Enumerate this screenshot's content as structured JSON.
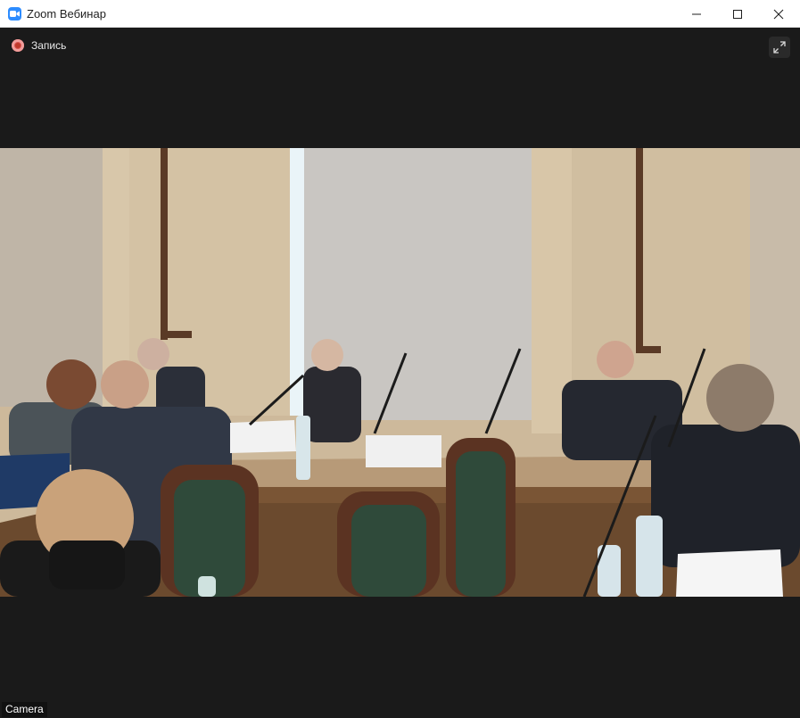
{
  "window": {
    "title": "Zoom Вебинар"
  },
  "toolbar": {
    "recording_label": "Запись"
  },
  "video": {
    "participant_label": "Camera"
  },
  "icons": {
    "app": "zoom-camera-icon",
    "minimize": "minimize-icon",
    "maximize": "maximize-icon",
    "close": "close-icon",
    "recording": "recording-dot-icon",
    "fullscreen": "fullscreen-icon"
  },
  "colors": {
    "brand": "#2d8cff",
    "recording": "#d9534f",
    "background": "#1a1a1a"
  }
}
